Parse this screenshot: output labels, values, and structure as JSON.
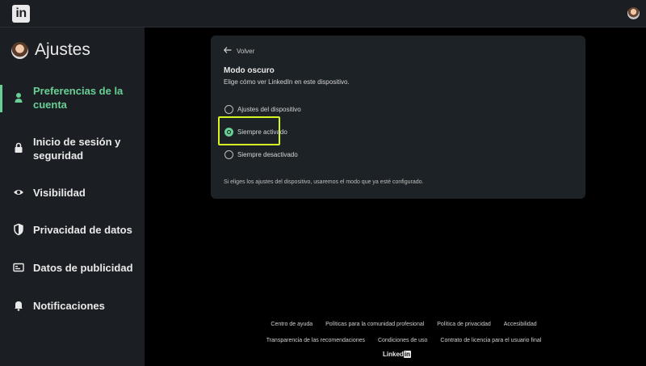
{
  "topbar": {
    "logo_text": "in",
    "logo_icon": "linkedin-logo",
    "avatar_icon": "user-avatar"
  },
  "sidebar": {
    "title": "Ajustes",
    "items": [
      {
        "label_line1": "Preferencias de la",
        "label_line2": "cuenta",
        "icon": "person-icon",
        "active": true
      },
      {
        "label_line1": "Inicio de sesión y",
        "label_line2": "seguridad",
        "icon": "lock-icon",
        "active": false
      },
      {
        "label_line1": "Visibilidad",
        "label_line2": "",
        "icon": "eye-icon",
        "active": false
      },
      {
        "label_line1": "Privacidad de datos",
        "label_line2": "",
        "icon": "shield-icon",
        "active": false
      },
      {
        "label_line1": "Datos de publicidad",
        "label_line2": "",
        "icon": "card-icon",
        "active": false
      },
      {
        "label_line1": "Notificaciones",
        "label_line2": "",
        "icon": "bell-icon",
        "active": false
      }
    ]
  },
  "card": {
    "back_label": "Volver",
    "title": "Modo oscuro",
    "description": "Elige cómo ver LinkedIn en este dispositivo.",
    "options": [
      {
        "label": "Ajustes del dispositivo",
        "checked": false
      },
      {
        "label": "Siempre activado",
        "checked": true
      },
      {
        "label": "Siempre desactivado",
        "checked": false
      }
    ],
    "note": "Si eliges los ajustes del dispositivo, usaremos el modo que ya esté configurado."
  },
  "footer": {
    "row1": [
      "Centro de ayuda",
      "Políticas para la comunidad profesional",
      "Política de privacidad",
      "Accesibilidad"
    ],
    "row2": [
      "Transparencia de las recomendaciones",
      "Condiciones de uso",
      "Contrato de licencia para el usuario final"
    ],
    "brand_word": "Linked",
    "brand_in": "in"
  },
  "colors": {
    "accent": "#69d095",
    "highlight": "#d6f523",
    "background": "#000000",
    "panel": "#1b1f23"
  }
}
